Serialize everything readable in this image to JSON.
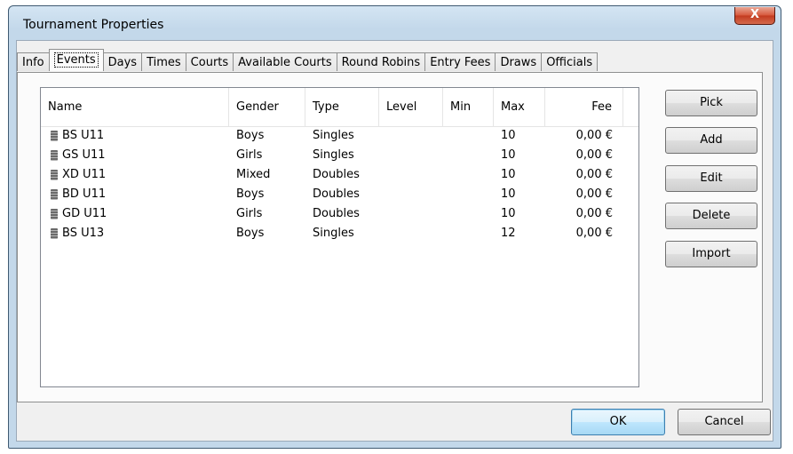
{
  "window": {
    "title": "Tournament Properties",
    "close_label": "X"
  },
  "tabs": [
    {
      "label": "Info"
    },
    {
      "label": "Events"
    },
    {
      "label": "Days"
    },
    {
      "label": "Times"
    },
    {
      "label": "Courts"
    },
    {
      "label": "Available Courts"
    },
    {
      "label": "Round Robins"
    },
    {
      "label": "Entry Fees"
    },
    {
      "label": "Draws"
    },
    {
      "label": "Officials"
    }
  ],
  "active_tab": "Events",
  "events_table": {
    "columns": [
      "Name",
      "Gender",
      "Type",
      "Level",
      "Min",
      "Max",
      "Fee"
    ],
    "rows": [
      {
        "name": "BS U11",
        "gender": "Boys",
        "type": "Singles",
        "level": "",
        "min": "",
        "max": "10",
        "fee": "0,00 €"
      },
      {
        "name": "GS U11",
        "gender": "Girls",
        "type": "Singles",
        "level": "",
        "min": "",
        "max": "10",
        "fee": "0,00 €"
      },
      {
        "name": "XD U11",
        "gender": "Mixed",
        "type": "Doubles",
        "level": "",
        "min": "",
        "max": "10",
        "fee": "0,00 €"
      },
      {
        "name": "BD U11",
        "gender": "Boys",
        "type": "Doubles",
        "level": "",
        "min": "",
        "max": "10",
        "fee": "0,00 €"
      },
      {
        "name": "GD U11",
        "gender": "Girls",
        "type": "Doubles",
        "level": "",
        "min": "",
        "max": "10",
        "fee": "0,00 €"
      },
      {
        "name": "BS U13",
        "gender": "Boys",
        "type": "Singles",
        "level": "",
        "min": "",
        "max": "12",
        "fee": "0,00 €"
      }
    ]
  },
  "side_buttons": {
    "pick": "Pick",
    "add": "Add",
    "edit": "Edit",
    "delete": "Delete",
    "import": "Import"
  },
  "footer": {
    "ok": "OK",
    "cancel": "Cancel"
  }
}
